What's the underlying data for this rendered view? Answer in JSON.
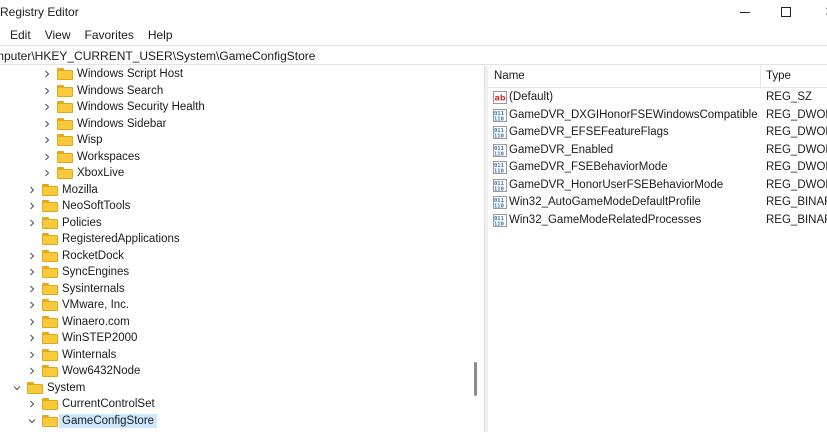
{
  "window": {
    "title": "Registry Editor",
    "minimize_glyph": "",
    "maximize_glyph": "",
    "close_glyph": "✕"
  },
  "menu": [
    {
      "label": "Edit"
    },
    {
      "label": "View"
    },
    {
      "label": "Favorites"
    },
    {
      "label": "Help"
    }
  ],
  "address": {
    "path": "mputer\\HKEY_CURRENT_USER\\System\\GameConfigStore"
  },
  "tree": [
    {
      "label": "Windows Script Host",
      "level": 3,
      "expander": "collapsed"
    },
    {
      "label": "Windows Search",
      "level": 3,
      "expander": "collapsed"
    },
    {
      "label": "Windows Security Health",
      "level": 3,
      "expander": "collapsed"
    },
    {
      "label": "Windows Sidebar",
      "level": 3,
      "expander": "collapsed"
    },
    {
      "label": "Wisp",
      "level": 3,
      "expander": "collapsed"
    },
    {
      "label": "Workspaces",
      "level": 3,
      "expander": "collapsed"
    },
    {
      "label": "XboxLive",
      "level": 3,
      "expander": "collapsed"
    },
    {
      "label": "Mozilla",
      "level": 2,
      "expander": "collapsed"
    },
    {
      "label": "NeoSoftTools",
      "level": 2,
      "expander": "collapsed"
    },
    {
      "label": "Policies",
      "level": 2,
      "expander": "collapsed"
    },
    {
      "label": "RegisteredApplications",
      "level": 2,
      "expander": "none"
    },
    {
      "label": "RocketDock",
      "level": 2,
      "expander": "collapsed"
    },
    {
      "label": "SyncEngines",
      "level": 2,
      "expander": "collapsed"
    },
    {
      "label": "Sysinternals",
      "level": 2,
      "expander": "collapsed"
    },
    {
      "label": "VMware, Inc.",
      "level": 2,
      "expander": "collapsed"
    },
    {
      "label": "Winaero.com",
      "level": 2,
      "expander": "collapsed"
    },
    {
      "label": "WinSTEP2000",
      "level": 2,
      "expander": "collapsed"
    },
    {
      "label": "Winternals",
      "level": 2,
      "expander": "collapsed"
    },
    {
      "label": "Wow6432Node",
      "level": 2,
      "expander": "collapsed"
    },
    {
      "label": "System",
      "level": 1,
      "expander": "expanded"
    },
    {
      "label": "CurrentControlSet",
      "level": 2,
      "expander": "collapsed"
    },
    {
      "label": "GameConfigStore",
      "level": 2,
      "expander": "expanded",
      "selected": true
    }
  ],
  "list": {
    "columns": {
      "name": "Name",
      "type": "Type"
    },
    "rows": [
      {
        "name": "(Default)",
        "type": "REG_SZ",
        "icon": "string-value-icon"
      },
      {
        "name": "GameDVR_DXGIHonorFSEWindowsCompatible",
        "type": "REG_DWORD",
        "icon": "binary-value-icon"
      },
      {
        "name": "GameDVR_EFSEFeatureFlags",
        "type": "REG_DWORD",
        "icon": "binary-value-icon"
      },
      {
        "name": "GameDVR_Enabled",
        "type": "REG_DWORD",
        "icon": "binary-value-icon"
      },
      {
        "name": "GameDVR_FSEBehaviorMode",
        "type": "REG_DWORD",
        "icon": "binary-value-icon"
      },
      {
        "name": "GameDVR_HonorUserFSEBehaviorMode",
        "type": "REG_DWORD",
        "icon": "binary-value-icon"
      },
      {
        "name": "Win32_AutoGameModeDefaultProfile",
        "type": "REG_BINARY",
        "icon": "binary-value-icon"
      },
      {
        "name": "Win32_GameModeRelatedProcesses",
        "type": "REG_BINARY",
        "icon": "binary-value-icon"
      }
    ]
  },
  "colors": {
    "folder": "#f8c93a",
    "selection": "#cce8ff",
    "value_icon_blue": "#2f6fc7",
    "value_icon_red": "#c8312b"
  }
}
